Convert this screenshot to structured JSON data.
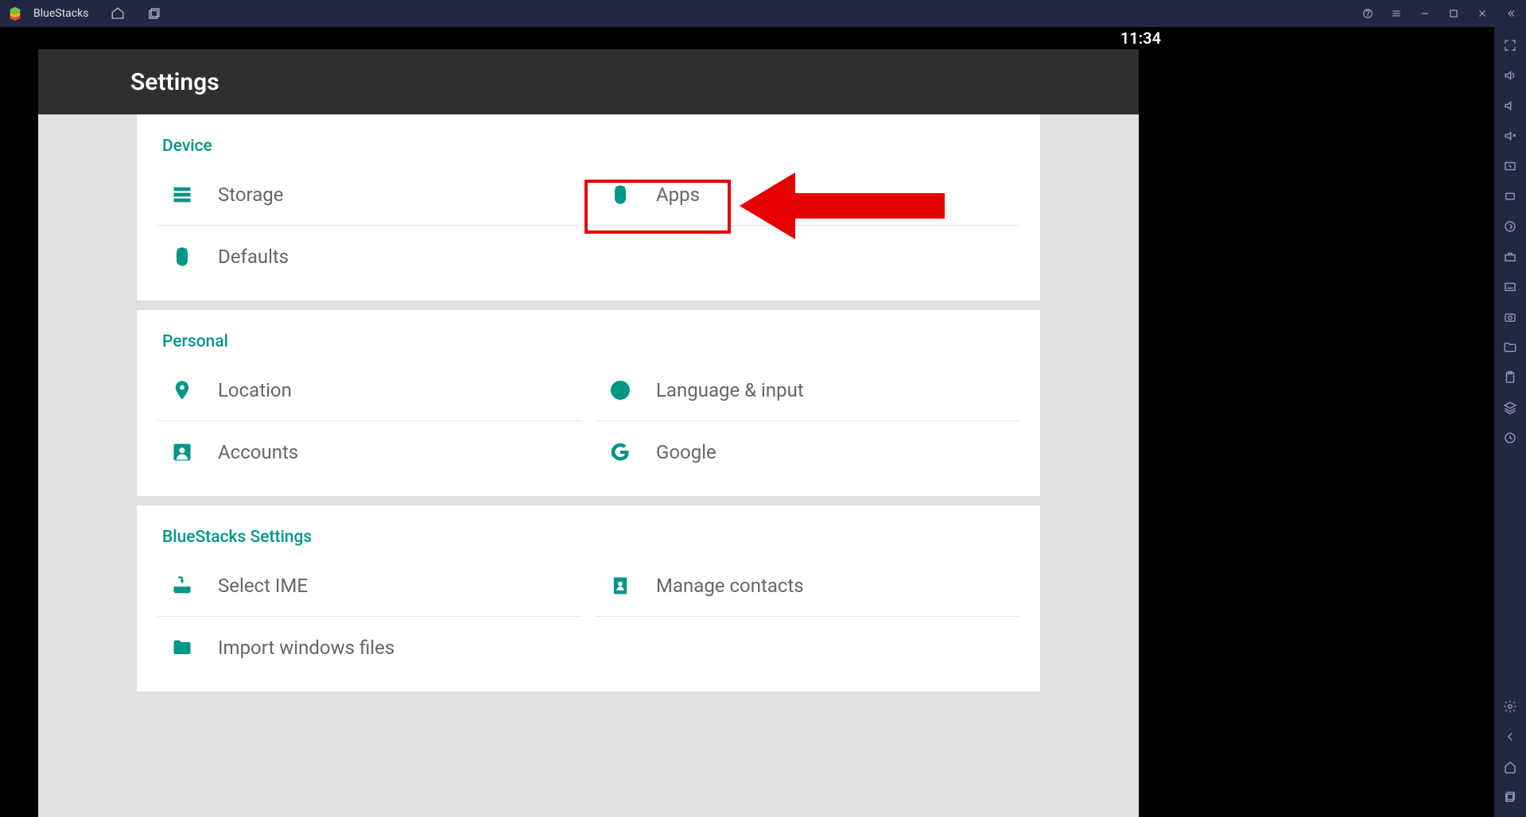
{
  "titlebar": {
    "app_name": "BlueStacks"
  },
  "status": {
    "time": "11:34"
  },
  "settings": {
    "title": "Settings",
    "sections": [
      {
        "label": "Device",
        "items": [
          {
            "name": "storage",
            "label": "Storage"
          },
          {
            "name": "apps",
            "label": "Apps"
          },
          {
            "name": "defaults",
            "label": "Defaults"
          }
        ]
      },
      {
        "label": "Personal",
        "items": [
          {
            "name": "location",
            "label": "Location"
          },
          {
            "name": "language-input",
            "label": "Language & input"
          },
          {
            "name": "accounts",
            "label": "Accounts"
          },
          {
            "name": "google",
            "label": "Google"
          }
        ]
      },
      {
        "label": "BlueStacks Settings",
        "items": [
          {
            "name": "select-ime",
            "label": "Select IME"
          },
          {
            "name": "manage-contacts",
            "label": "Manage contacts"
          },
          {
            "name": "import-files",
            "label": "Import windows files"
          }
        ]
      }
    ]
  },
  "colors": {
    "teal": "#009688",
    "highlight_red": "#e60000",
    "titlebar_bg": "#232842",
    "header_bg": "#2f2f2f"
  }
}
